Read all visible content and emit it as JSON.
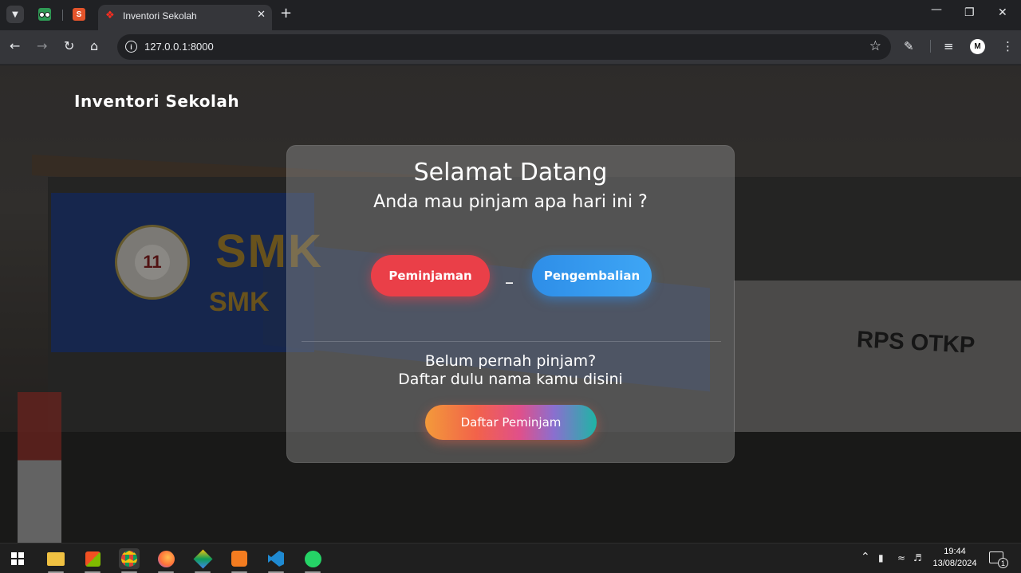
{
  "browser": {
    "tab_title": "Inventori Sekolah",
    "pinned_tab_2_letter": "S",
    "url": "127.0.0.1:8000",
    "profile_initial": "M"
  },
  "page": {
    "brand": "Inventori Sekolah",
    "background_sign_text": "SMK",
    "background_seal_number": "11",
    "background_wall_label": "RPS OTKP",
    "card": {
      "title": "Selamat Datang",
      "subtitle": "Anda mau pinjam apa hari ini ?",
      "buttons": {
        "borrow": "Peminjaman",
        "separator": "_",
        "return": "Pengembalian"
      },
      "hint_line1": "Belum pernah pinjam?",
      "hint_line2": "Daftar dulu nama kamu disini",
      "register_button": "Daftar Peminjam"
    },
    "colors": {
      "borrow_button": "#ea3f48",
      "return_button": "#2e8ee8"
    }
  },
  "taskbar": {
    "apps": [
      "start",
      "file-explorer",
      "microsoft-store",
      "chrome",
      "firefox",
      "git",
      "xampp",
      "vscode",
      "whatsapp"
    ],
    "time": "19:44",
    "date": "13/08/2024",
    "notification_count": "1"
  }
}
